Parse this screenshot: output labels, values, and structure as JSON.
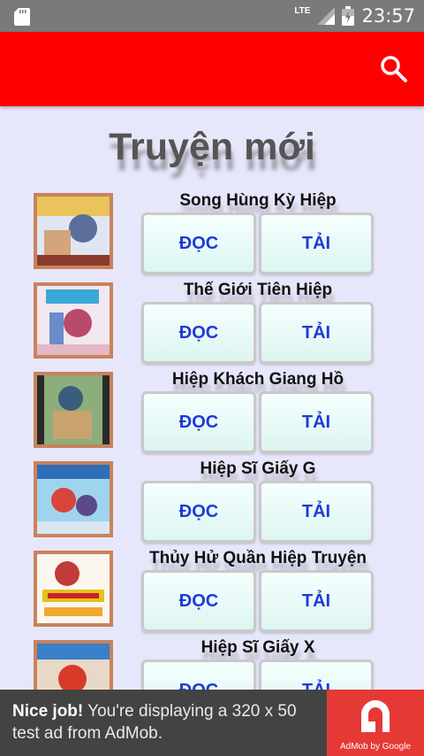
{
  "status": {
    "network": "LTE",
    "time": "23:57"
  },
  "appbar": {
    "color": "#ff0000"
  },
  "page": {
    "title": "Truyện mới"
  },
  "rows": [
    {
      "title": "Song Hùng Kỳ Hiệp",
      "read": "ĐỌC",
      "download": "TẢI"
    },
    {
      "title": "Thế Giới Tiên Hiệp",
      "read": "ĐỌC",
      "download": "TẢI"
    },
    {
      "title": "Hiệp Khách Giang Hồ",
      "read": "ĐỌC",
      "download": "TẢI"
    },
    {
      "title": "Hiệp Sĩ Giấy G",
      "read": "ĐỌC",
      "download": "TẢI"
    },
    {
      "title": "Thủy Hử Quần Hiệp Truyện",
      "read": "ĐỌC",
      "download": "TẢI"
    },
    {
      "title": "Hiệp Sĩ Giấy X",
      "read": "ĐỌC",
      "download": "TẢI"
    }
  ],
  "ad": {
    "bold": "Nice job!",
    "text": " You're displaying a 320 x 50 test ad from AdMob.",
    "caption": "AdMob by Google"
  }
}
